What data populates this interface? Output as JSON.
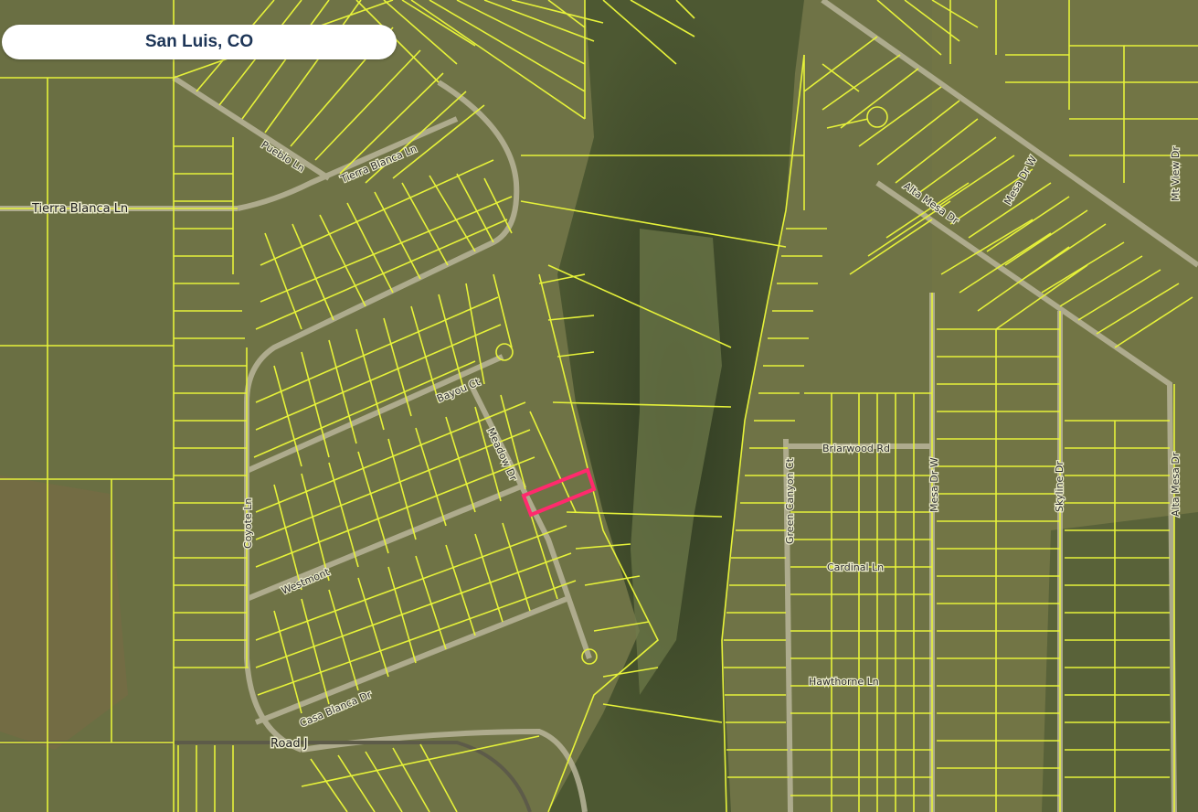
{
  "location": {
    "title": "San Luis, CO"
  },
  "colors": {
    "parcel_line": "#e6f23a",
    "highlight": "#ff2a6d",
    "terrain_base": "#6f7346",
    "canyon": "#3b4a2c",
    "pill_text": "#1d3557",
    "road": "#b9b59a"
  },
  "labels": {
    "tierra_blanca_ln": "Tierra Blanca Ln",
    "tierra_blanca_ln_2": "Tierra Blanca Ln",
    "pueblo_ln": "Pueblo Ln",
    "coyote_ln": "Coyote Ln",
    "bayou_ct": "Bayou Ct",
    "meadow_dr": "Meadow Dr",
    "westmont": "Westmont",
    "casa_blanca": "Casa Blanca Dr",
    "road_j": "Road J",
    "briarwood_rd": "Briarwood Rd",
    "green_canyon_ct": "Green Canyon Ct",
    "cardinal_ln": "Cardinal Ln",
    "hawthorne_ln": "Hawthorne Ln",
    "mesa_dr_w": "Mesa Dr W",
    "skyline_dr": "Skyline Dr",
    "alta_mesa_dr": "Alta Mesa Dr",
    "alta_mesa_dr_2": "Alta Mesa Dr",
    "mesa_dr_e": "Mesa Dr W",
    "vista_dr": "Mt View Dr"
  }
}
